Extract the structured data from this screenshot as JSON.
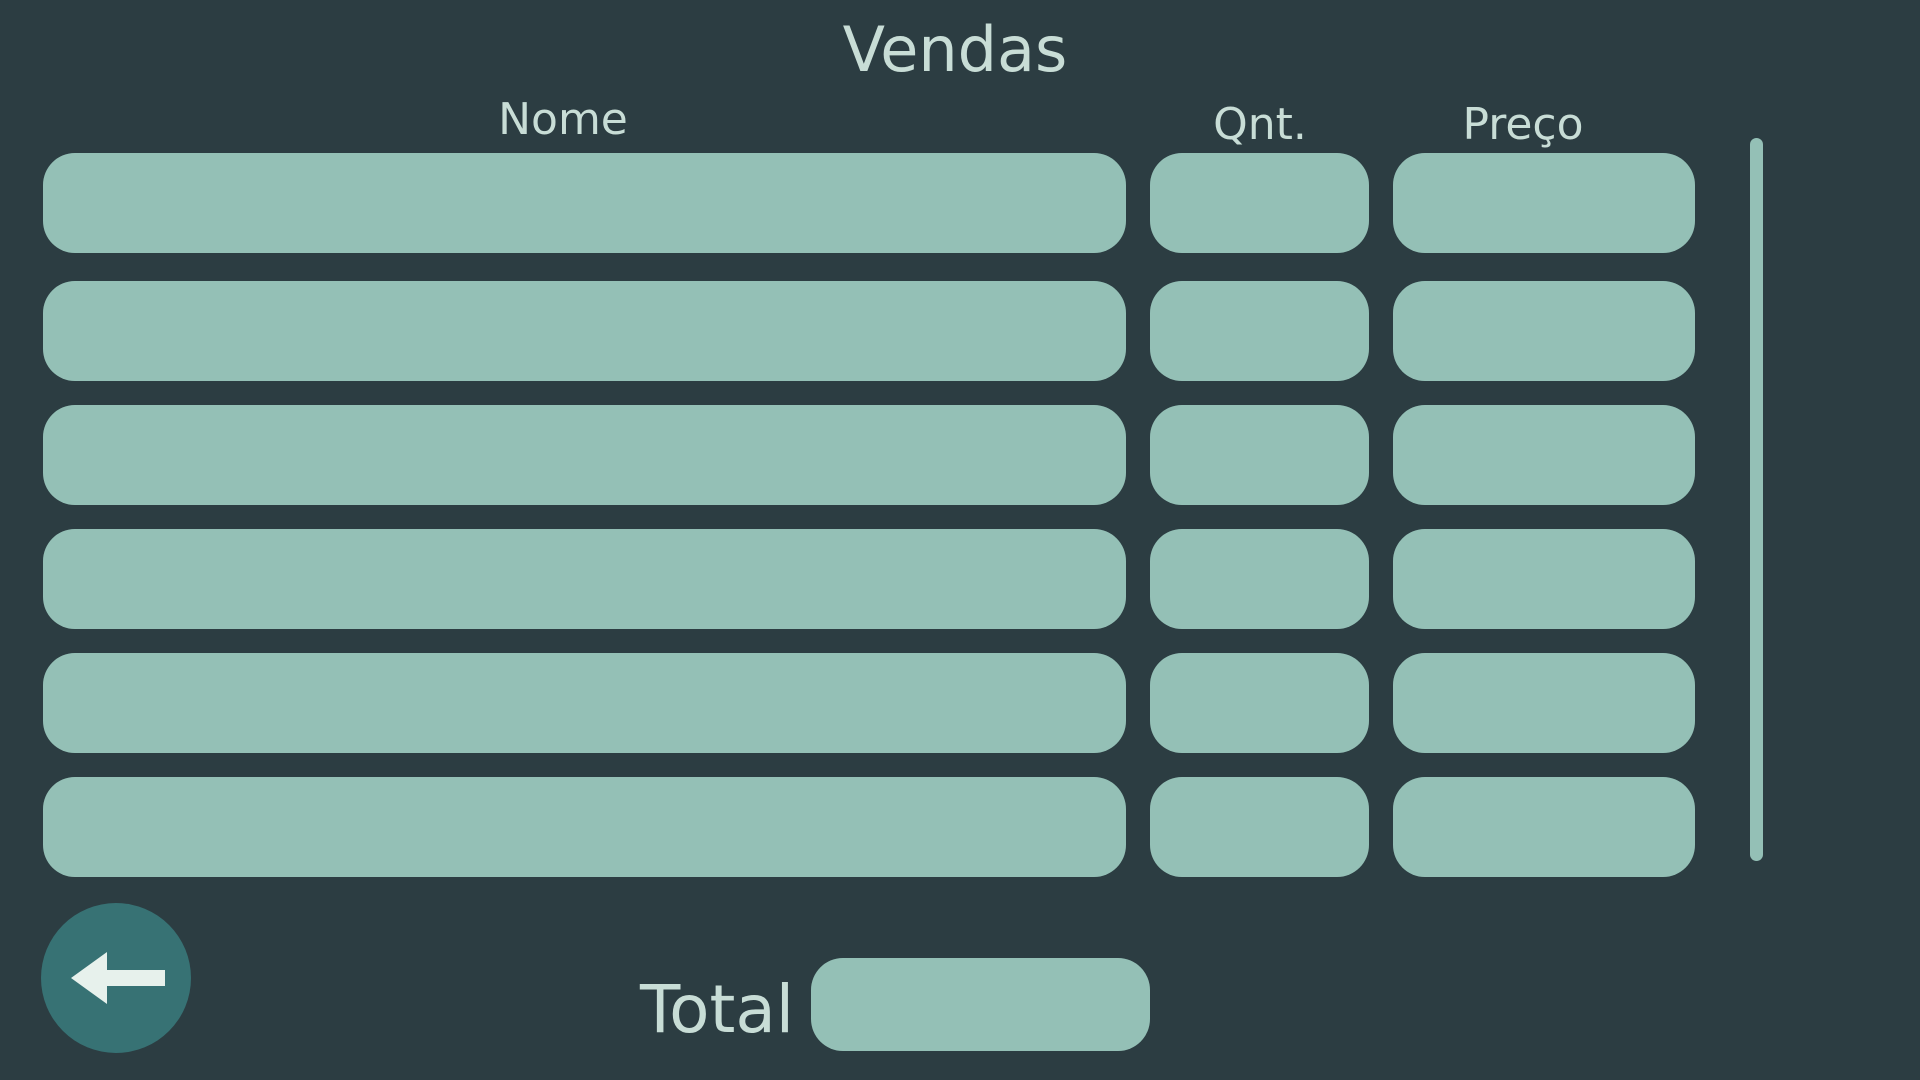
{
  "title": "Vendas",
  "columns": {
    "nome": "Nome",
    "qnt": "Qnt.",
    "preco": "Preço"
  },
  "rows": [
    {
      "nome": "",
      "qnt": "",
      "preco": ""
    },
    {
      "nome": "",
      "qnt": "",
      "preco": ""
    },
    {
      "nome": "",
      "qnt": "",
      "preco": ""
    },
    {
      "nome": "",
      "qnt": "",
      "preco": ""
    },
    {
      "nome": "",
      "qnt": "",
      "preco": ""
    },
    {
      "nome": "",
      "qnt": "",
      "preco": ""
    }
  ],
  "total": {
    "label": "Total",
    "value": ""
  },
  "back_button": {
    "icon": "arrow-left-icon"
  },
  "colors": {
    "background": "#2c3d42",
    "field": "#94c0b6",
    "text": "#c8ddd6",
    "button": "#377274",
    "icon": "#e7f1ec"
  }
}
